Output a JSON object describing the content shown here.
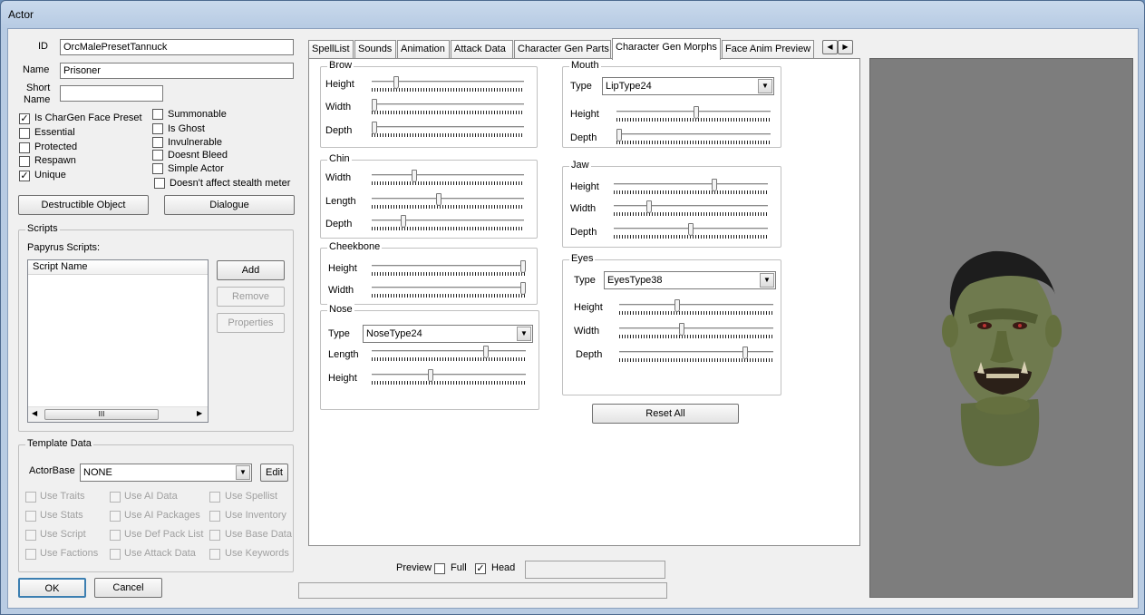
{
  "window": {
    "title": "Actor"
  },
  "left": {
    "id_label": "ID",
    "id_value": "OrcMalePresetTannuck",
    "name_label": "Name",
    "name_value": "Prisoner",
    "short_name_label_1": "Short",
    "short_name_label_2": "Name",
    "short_name_value": "",
    "flags_left": [
      {
        "label": "Is CharGen Face Preset",
        "checked": true
      },
      {
        "label": "Essential",
        "checked": false
      },
      {
        "label": "Protected",
        "checked": false
      },
      {
        "label": "Respawn",
        "checked": false
      },
      {
        "label": "Unique",
        "checked": true
      }
    ],
    "flags_right": [
      {
        "label": "Summonable",
        "checked": false
      },
      {
        "label": "Is Ghost",
        "checked": false
      },
      {
        "label": "Invulnerable",
        "checked": false
      },
      {
        "label": "Doesnt Bleed",
        "checked": false
      },
      {
        "label": "Simple Actor",
        "checked": false
      },
      {
        "label": "Doesn't affect stealth meter",
        "checked": false
      }
    ],
    "destructible_button": "Destructible Object",
    "dialogue_button": "Dialogue",
    "scripts": {
      "group_title": "Scripts",
      "papyrus_label": "Papyrus Scripts:",
      "column_header": "Script Name",
      "add": "Add",
      "remove": "Remove",
      "properties": "Properties",
      "scroll_grip": "III"
    },
    "template": {
      "group_title": "Template Data",
      "actorbase_label": "ActorBase",
      "actorbase_value": "NONE",
      "edit": "Edit",
      "uses": [
        [
          "Use Traits",
          "Use AI Data",
          "Use Spellist"
        ],
        [
          "Use Stats",
          "Use AI Packages",
          "Use Inventory"
        ],
        [
          "Use Script",
          "Use Def Pack List",
          "Use Base Data"
        ],
        [
          "Use Factions",
          "Use Attack Data",
          "Use Keywords"
        ]
      ]
    },
    "ok": "OK",
    "cancel": "Cancel"
  },
  "tabs": [
    {
      "label": "SpellList"
    },
    {
      "label": "Sounds"
    },
    {
      "label": "Animation"
    },
    {
      "label": "Attack Data"
    },
    {
      "label": "Character Gen Parts"
    },
    {
      "label": "Character Gen Morphs",
      "selected": true
    },
    {
      "label": "Face Anim Preview"
    }
  ],
  "tab_scroll": {
    "left": "◀",
    "right": "▶"
  },
  "morphs": {
    "brow": {
      "title": "Brow",
      "height_label": "Height",
      "height": 0.15,
      "width_label": "Width",
      "width": 0.0,
      "depth_label": "Depth",
      "depth": 0.0
    },
    "chin": {
      "title": "Chin",
      "width_label": "Width",
      "width": 0.27,
      "length_label": "Length",
      "length": 0.44,
      "depth_label": "Depth",
      "depth": 0.2
    },
    "cheekbone": {
      "title": "Cheekbone",
      "height_label": "Height",
      "height": 1.0,
      "width_label": "Width",
      "width": 1.0
    },
    "nose": {
      "title": "Nose",
      "type_label": "Type",
      "type_value": "NoseType24",
      "length_label": "Length",
      "length": 0.75,
      "height_label": "Height",
      "height": 0.38
    },
    "mouth": {
      "title": "Mouth",
      "type_label": "Type",
      "type_value": "LipType24",
      "height_label": "Height",
      "height": 0.52,
      "depth_label": "Depth",
      "depth": 0.0
    },
    "jaw": {
      "title": "Jaw",
      "height_label": "Height",
      "height": 0.66,
      "width_label": "Width",
      "width": 0.22,
      "depth_label": "Depth",
      "depth": 0.5
    },
    "eyes": {
      "title": "Eyes",
      "type_label": "Type",
      "type_value": "EyesType38",
      "height_label": "Height",
      "height": 0.37,
      "width_label": "Width",
      "width": 0.4,
      "depth_label": "Depth",
      "depth": 0.83
    },
    "reset_all": "Reset All"
  },
  "bottom": {
    "preview_label": "Preview",
    "full_label": "Full",
    "full_checked": false,
    "head_label": "Head",
    "head_checked": true,
    "status_text": ""
  },
  "preview_image": {
    "subject": "orc-head-icon"
  },
  "colors": {
    "skin": "#6f7a4e",
    "hair": "#1d1d1d",
    "viewport": "#7d7d7d"
  }
}
